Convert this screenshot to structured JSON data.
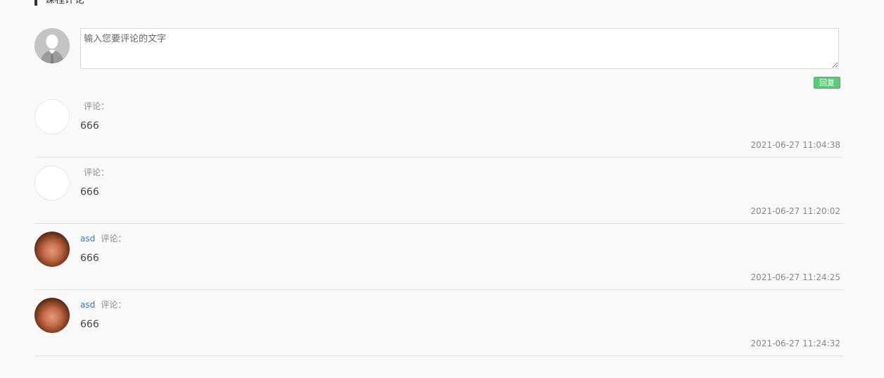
{
  "section": {
    "title": "课程评论"
  },
  "composer": {
    "placeholder": "输入您要评论的文字",
    "reply_label": "回复"
  },
  "comments": [
    {
      "author": "",
      "label": "评论：",
      "text": "666",
      "time": "2021-06-27 11:04:38",
      "avatar": "empty"
    },
    {
      "author": "",
      "label": "评论：",
      "text": "666",
      "time": "2021-06-27 11:20:02",
      "avatar": "empty"
    },
    {
      "author": "asd",
      "label": "评论：",
      "text": "666",
      "time": "2021-06-27 11:24:25",
      "avatar": "photo"
    },
    {
      "author": "asd",
      "label": "评论：",
      "text": "666",
      "time": "2021-06-27 11:24:32",
      "avatar": "photo"
    }
  ],
  "colors": {
    "accent_green": "#5cc878",
    "author_blue": "#3a76c4",
    "background": "#f9f9f9"
  }
}
